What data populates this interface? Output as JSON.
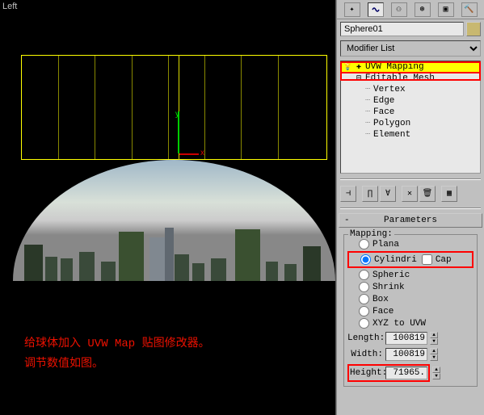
{
  "viewport": {
    "label": "Left",
    "axis_x": "x",
    "axis_y": "y"
  },
  "annotation": {
    "line1": "给球体加入 UVW Map 贴图修改器。",
    "line2": "调节数值如图。"
  },
  "object": {
    "name": "Sphere01"
  },
  "modifier_list": {
    "label": "Modifier List"
  },
  "stack": {
    "items": [
      {
        "icon_eye": "👁",
        "icon_plus": "➕",
        "label": "UVW Mapping",
        "selected": true
      },
      {
        "icon_eye": "",
        "icon_plus": "⊟",
        "label": "Editable Mesh",
        "selected": false
      }
    ],
    "subs": [
      {
        "label": "Vertex"
      },
      {
        "label": "Edge"
      },
      {
        "label": "Face"
      },
      {
        "label": "Polygon"
      },
      {
        "label": "Element"
      }
    ]
  },
  "rollout": {
    "title": "Parameters",
    "minus": "-"
  },
  "mapping": {
    "group_label": "Mapping:",
    "options": {
      "plana": "Plana",
      "cylindri": "Cylindri",
      "cap": "Cap",
      "spheric": "Spheric",
      "shrink": "Shrink",
      "box": "Box",
      "face": "Face",
      "xyz": "XYZ to UVW"
    },
    "selected": "cylindri",
    "cap_checked": false
  },
  "dimensions": {
    "length_label": "Length:",
    "length_value": "100819",
    "width_label": "Width:",
    "width_value": "100819",
    "height_label": "Height:",
    "height_value": "71965."
  }
}
